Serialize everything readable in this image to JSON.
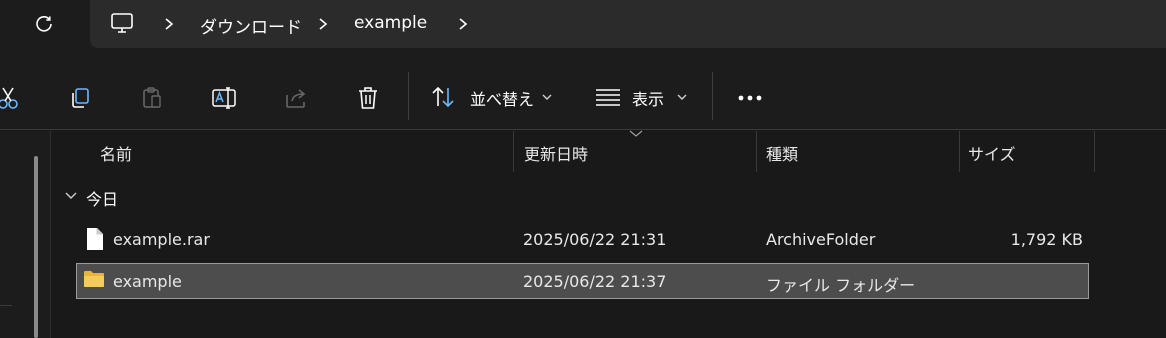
{
  "breadcrumb": {
    "items": [
      "ダウンロード",
      "example"
    ]
  },
  "toolbar": {
    "sort_label": "並べ替え",
    "view_label": "表示"
  },
  "columns": {
    "name": "名前",
    "modified": "更新日時",
    "type": "種類",
    "size": "サイズ"
  },
  "group": {
    "label": "今日"
  },
  "files": [
    {
      "name": "example.rar",
      "modified": "2025/06/22 21:31",
      "type": "ArchiveFolder",
      "size": "1,792 KB",
      "icon": "file-icon"
    },
    {
      "name": "example",
      "modified": "2025/06/22 21:37",
      "type": "ファイル フォルダー",
      "size": "",
      "icon": "folder-icon",
      "selected": true
    }
  ],
  "colors": {
    "background": "#191919",
    "address_field": "#2b2b2b",
    "selected_row": "#4d4d4d",
    "folder": "#f2c94c"
  }
}
